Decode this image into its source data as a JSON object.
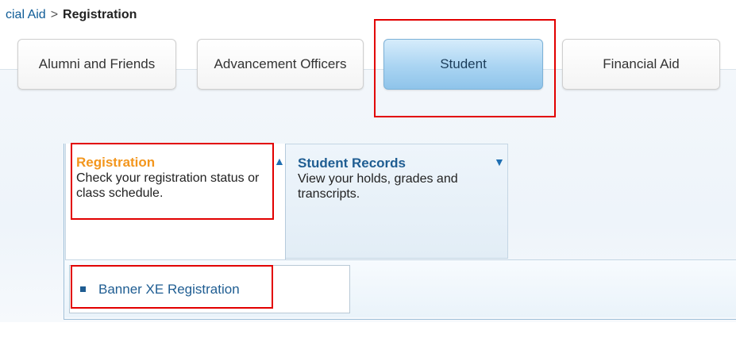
{
  "breadcrumb": {
    "link": "cial Aid",
    "separator": ">",
    "current": "Registration"
  },
  "tabs": [
    {
      "label": "Alumni and Friends",
      "active": false
    },
    {
      "label": "Advancement Officers",
      "active": false
    },
    {
      "label": "Student",
      "active": true
    },
    {
      "label": "Financial Aid",
      "active": false
    }
  ],
  "cards": {
    "registration": {
      "title": "Registration",
      "desc_line1": "Check your registration status or",
      "desc_line2": "class schedule.",
      "arrow": "▲"
    },
    "student_records": {
      "title": "Student Records",
      "desc_line1": "View your holds, grades and",
      "desc_line2": "transcripts.",
      "arrow": "▼"
    }
  },
  "submenu": {
    "items": [
      {
        "label": "Banner XE Registration"
      }
    ]
  },
  "colors": {
    "highlight_red": "#e20000",
    "link_blue": "#0f5c97",
    "registration_orange": "#f3961d",
    "records_blue": "#1f5d92"
  }
}
